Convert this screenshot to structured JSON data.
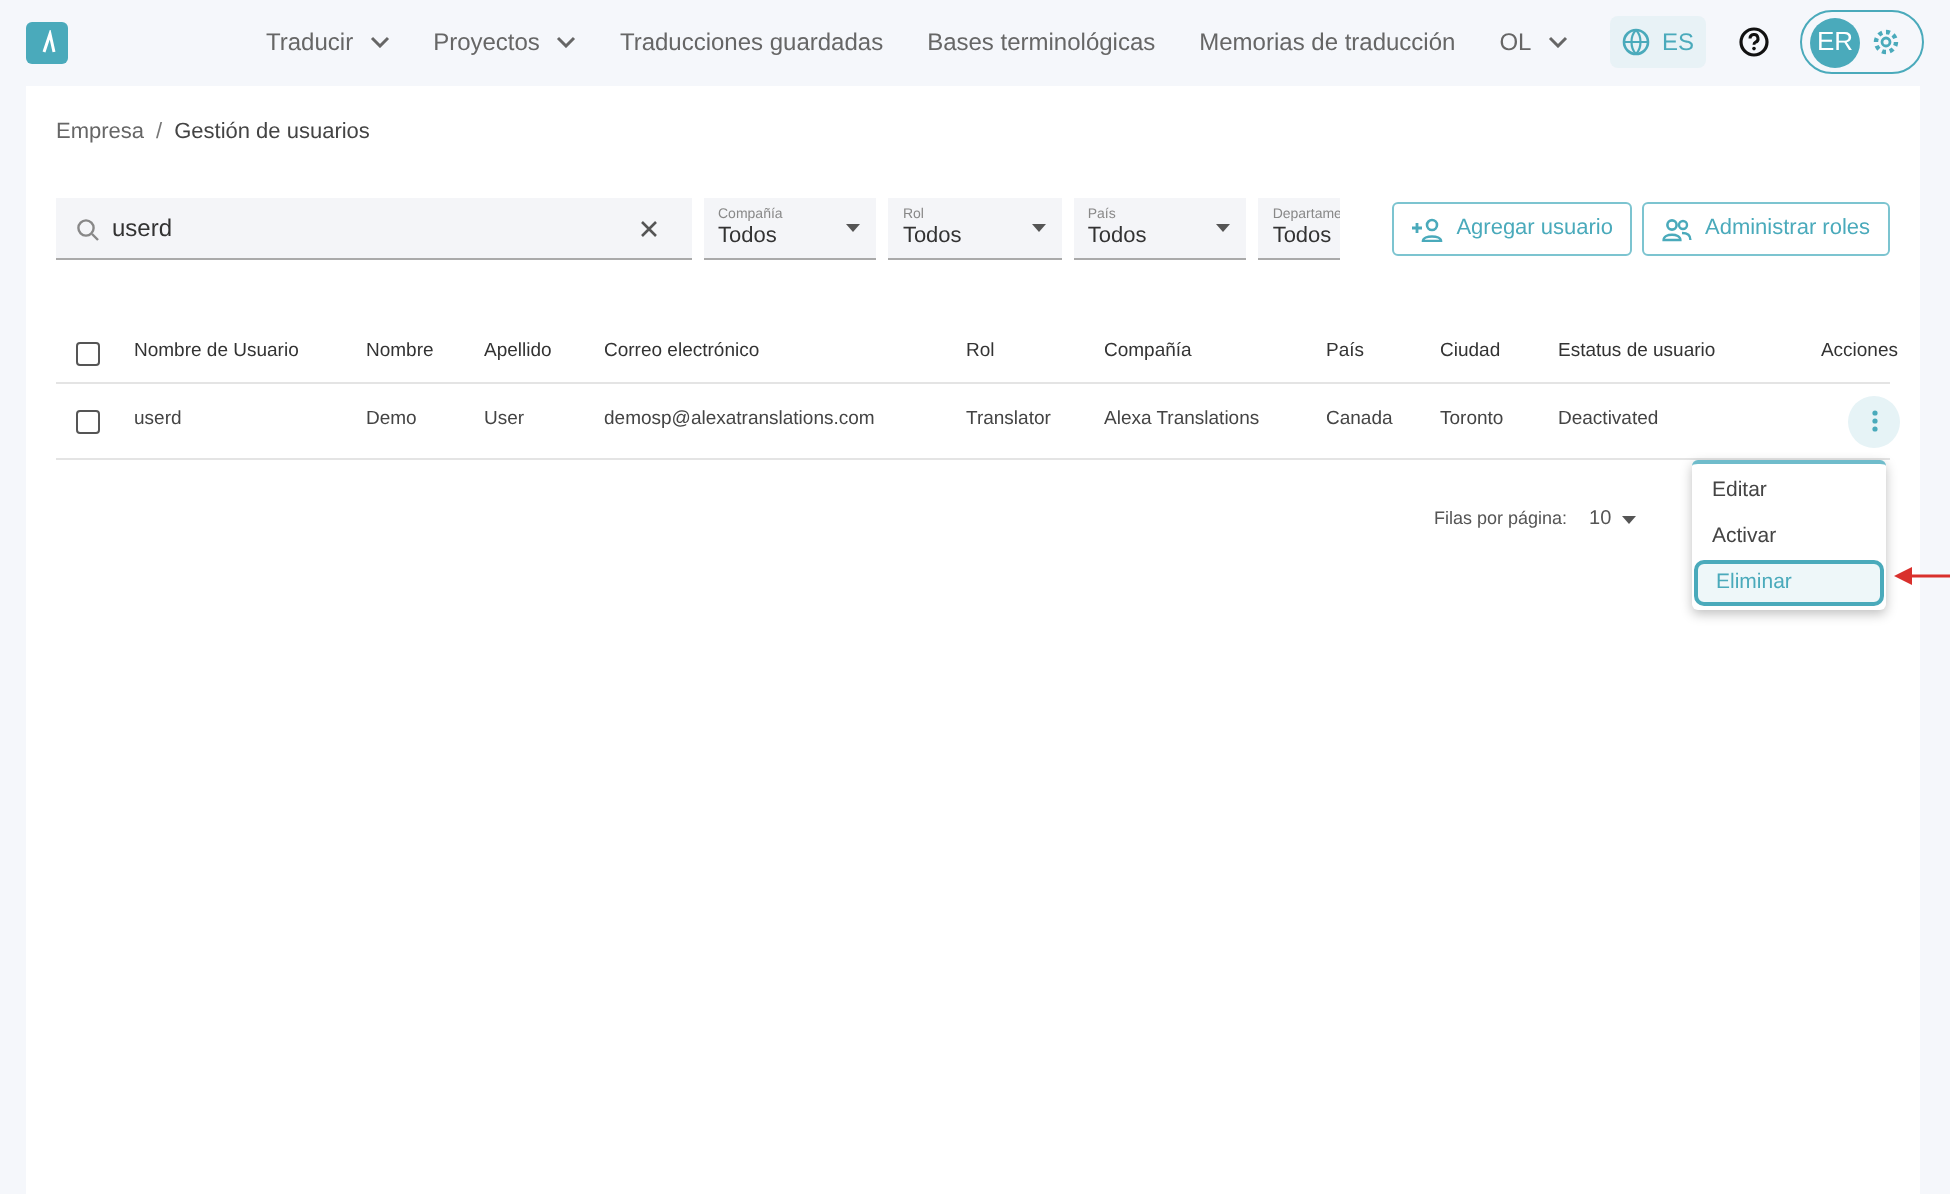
{
  "header": {
    "nav": [
      {
        "label": "Traducir",
        "dropdown": true
      },
      {
        "label": "Proyectos",
        "dropdown": true
      },
      {
        "label": "Traducciones guardadas",
        "dropdown": false
      },
      {
        "label": "Bases terminológicas",
        "dropdown": false
      },
      {
        "label": "Memorias de traducción",
        "dropdown": false
      },
      {
        "label": "OL",
        "dropdown": true
      }
    ],
    "language": "ES",
    "avatar": "ER"
  },
  "breadcrumb": {
    "items": [
      "Empresa",
      "Gestión de usuarios"
    ],
    "separator": "/"
  },
  "search": {
    "value": "userd"
  },
  "filters": [
    {
      "label": "Compañía",
      "value": "Todos"
    },
    {
      "label": "Rol",
      "value": "Todos"
    },
    {
      "label": "País",
      "value": "Todos"
    },
    {
      "label": "Departame",
      "value": "Todos"
    }
  ],
  "buttons": [
    "Agregar usuario",
    "Administrar roles"
  ],
  "table": {
    "columns": [
      "Nombre de Usuario",
      "Nombre",
      "Apellido",
      "Correo electrónico",
      "Rol",
      "Compañía",
      "País",
      "Ciudad",
      "Estatus de usuario",
      "Acciones"
    ],
    "header_checked": false,
    "rows": [
      {
        "checked": false,
        "cells": [
          "userd",
          "Demo",
          "User",
          "demosp@alexatranslations.com",
          "Translator",
          "Alexa Translations",
          "Canada",
          "Toronto",
          "Deactivated"
        ]
      }
    ]
  },
  "pagination": {
    "label": "Filas por página:",
    "value": "10"
  },
  "menu": [
    {
      "label": "Editar",
      "selected": false
    },
    {
      "label": "Activar",
      "selected": false
    },
    {
      "label": "Eliminar",
      "selected": true
    }
  ]
}
